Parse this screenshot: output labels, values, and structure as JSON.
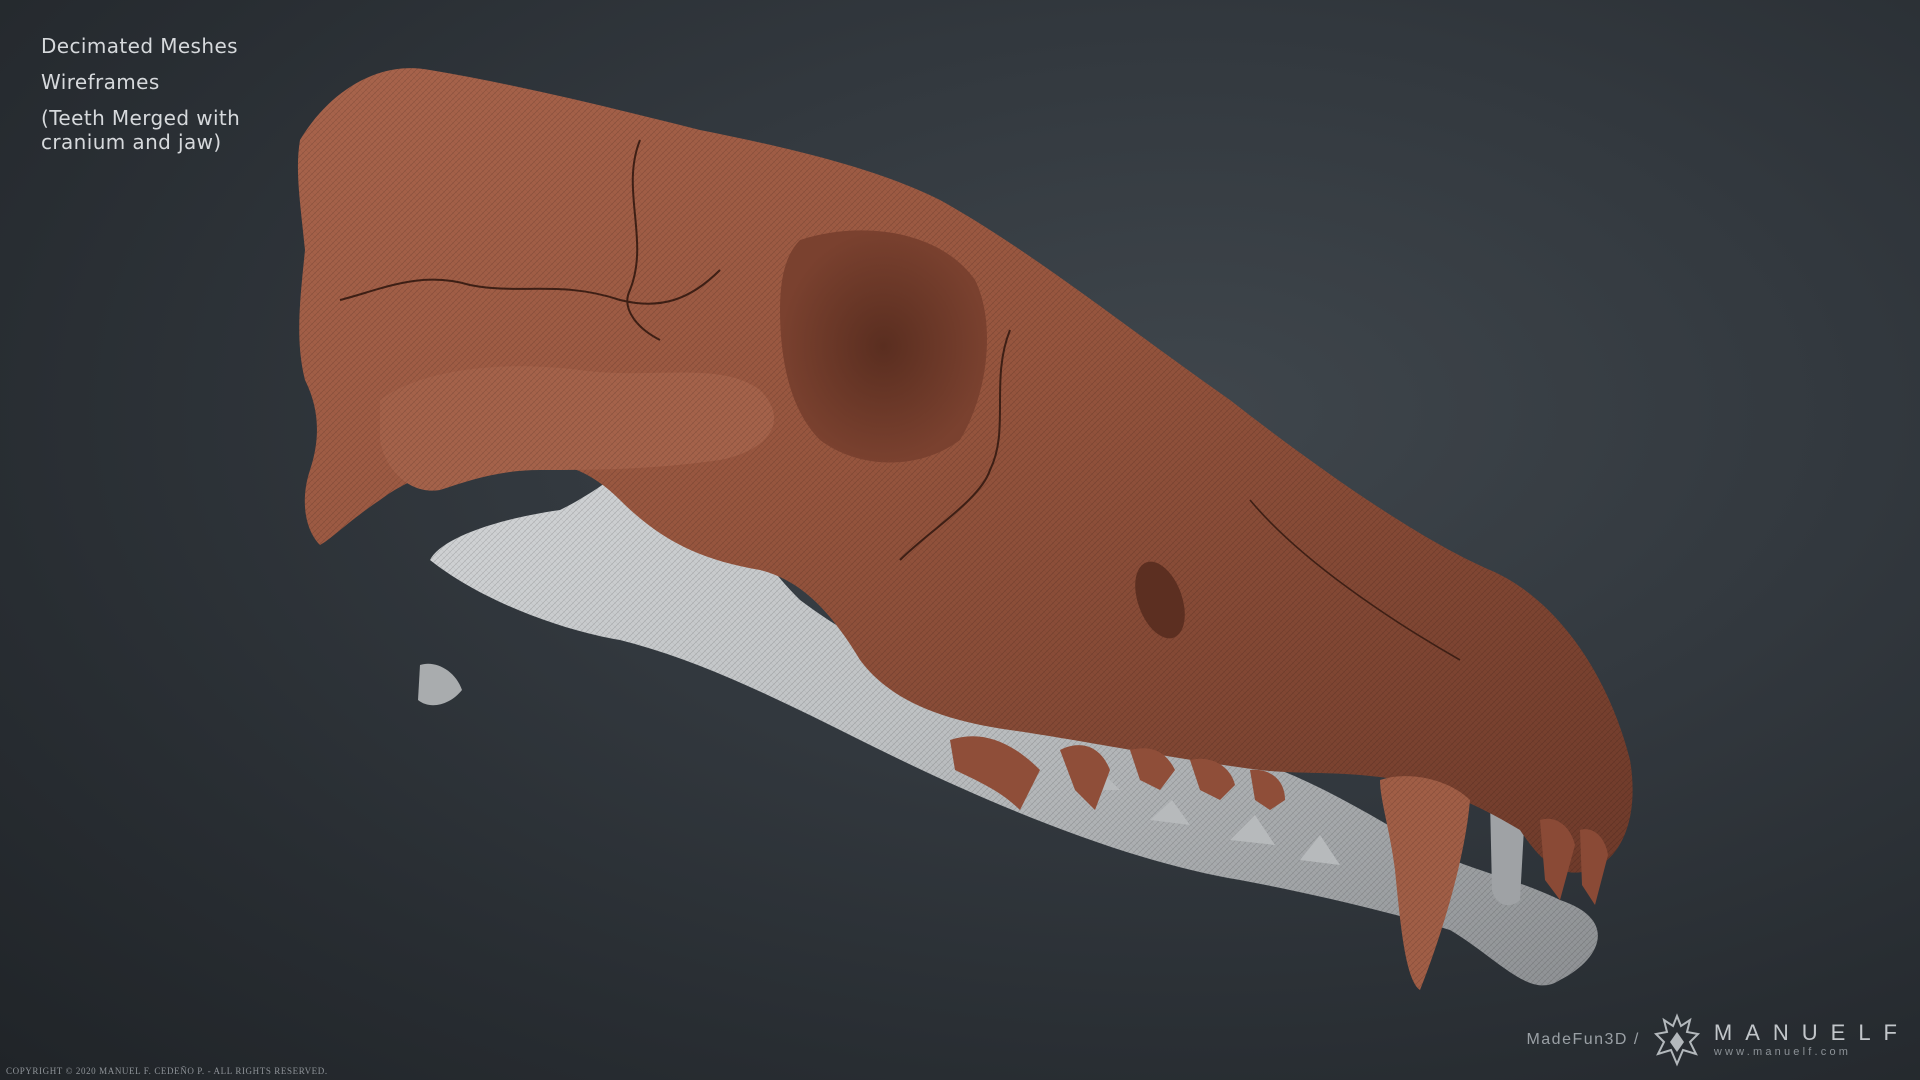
{
  "caption": {
    "line1": "Decimated Meshes",
    "line2": "Wireframes",
    "line3a": "(Teeth Merged with",
    "line3b": "cranium and jaw)"
  },
  "footer": {
    "copyright": "COPYRIGHT © 2020 MANUEL F. CEDEÑO P. - ALL RIGHTS RESERVED."
  },
  "brand": {
    "madefun": "MadeFun3D /",
    "name": "MANUELF",
    "site": "www.manuelf.com"
  },
  "colors": {
    "background": "#2e3439",
    "cranium": "#9b5a44",
    "mandible": "#c9cbcd",
    "caption_text": "#d6d9dc"
  },
  "icons": [
    "helmet-logo-icon"
  ]
}
